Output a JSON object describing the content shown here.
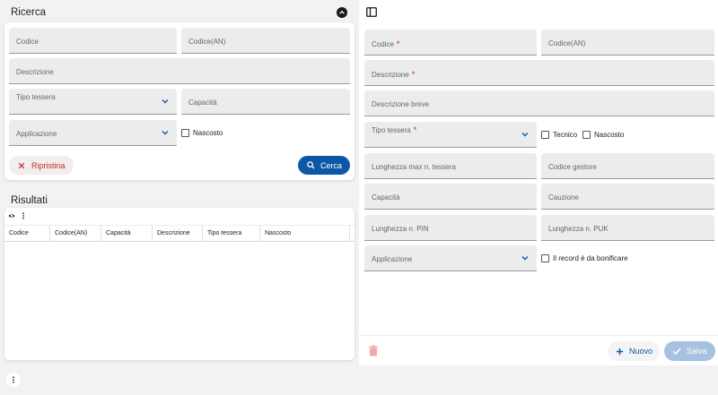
{
  "search": {
    "title": "Ricerca",
    "fields": {
      "codice": "Codice",
      "codice_an": "Codice(AN)",
      "descrizione": "Descrizione",
      "tipo_tessera": "Tipo tessera",
      "capacita": "Capacità",
      "applicazione": "Applicazione",
      "nascosto": "Nascosto"
    },
    "reset_label": "Ripristina",
    "search_label": "Cerca"
  },
  "results": {
    "title": "Risultati",
    "columns": [
      "Codice",
      "Codice(AN)",
      "Capacità",
      "Descrizione",
      "Tipo tessera",
      "Nascosto"
    ]
  },
  "detail": {
    "fields": {
      "codice": "Codice",
      "codice_an": "Codice(AN)",
      "descrizione": "Descrizione",
      "descrizione_breve": "Descrizione breve",
      "tipo_tessera": "Tipo tessera",
      "tecnico": "Tecnico",
      "nascosto": "Nascosto",
      "lunghezza_max": "Lunghezza max n. tessera",
      "codice_gestore": "Codice gestore",
      "capacita": "Capacità",
      "cauzione": "Cauzione",
      "lunghezza_pin": "Lunghezza n. PIN",
      "lunghezza_puk": "Lunghezza n. PUK",
      "applicazione": "Applicazione",
      "bonificare": "Il record è da bonificare"
    },
    "required_mark": "*",
    "new_label": "Nuovo",
    "save_label": "Salva"
  },
  "icons": {
    "collapse": "chevron-up-icon",
    "sidebar": "sidebar-panel-icon",
    "reset": "close-icon",
    "search": "search-icon",
    "visibility": "eye-icon",
    "menu": "more-vert-icon",
    "delete": "trash-icon",
    "add": "plus-icon",
    "save": "check-icon"
  },
  "colors": {
    "primary": "#0d58a6",
    "danger": "#c62828",
    "disabled_primary": "#a7c2e0"
  }
}
